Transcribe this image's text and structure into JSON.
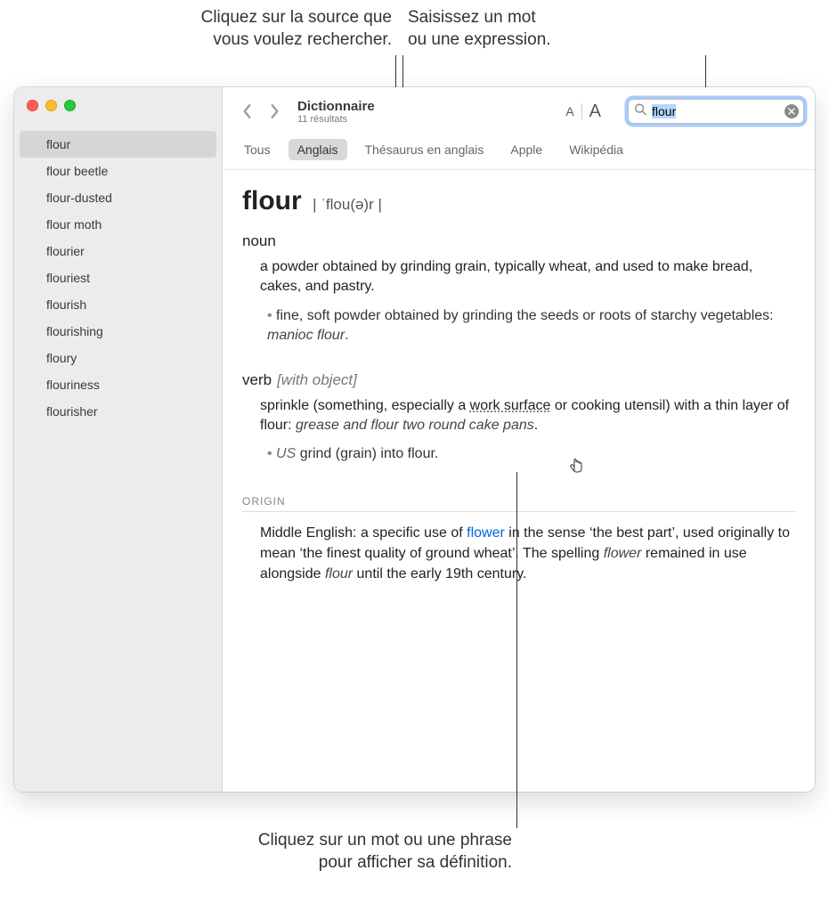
{
  "callouts": {
    "top_left_l1": "Cliquez sur la source que",
    "top_left_l2": "vous voulez rechercher.",
    "top_right_l1": "Saisissez un mot",
    "top_right_l2": "ou une expression.",
    "bottom_l1": "Cliquez sur un mot ou une phrase",
    "bottom_l2": "pour afficher sa définition."
  },
  "window": {
    "title": "Dictionnaire",
    "subtitle": "11 résultats"
  },
  "search": {
    "value": "flour"
  },
  "tabs": [
    "Tous",
    "Anglais",
    "Thésaurus en anglais",
    "Apple",
    "Wikipédia"
  ],
  "active_tab_index": 1,
  "sidebar": {
    "items": [
      "flour",
      "flour beetle",
      "flour-dusted",
      "flour moth",
      "flourier",
      "flouriest",
      "flourish",
      "flourishing",
      "floury",
      "flouriness",
      "flourisher"
    ],
    "selected_index": 0
  },
  "entry": {
    "headword": "flour",
    "pron": "| ˈflou(ə)r |",
    "noun_label": "noun",
    "noun_def": "a powder obtained by grinding grain, typically wheat, and used to make bread, cakes, and pastry.",
    "noun_sub_prefix": "fine, soft powder obtained by grinding the seeds or roots of starchy vegetables: ",
    "noun_sub_example": "manioc flour",
    "noun_sub_suffix": ".",
    "verb_label": "verb",
    "verb_grammar": "[with object]",
    "verb_def_prefix": "sprinkle (something, especially a ",
    "verb_def_link": "work surface",
    "verb_def_mid": " or cooking utensil) with a thin layer of flour: ",
    "verb_def_example": "grease and flour two round cake pans",
    "verb_def_suffix": ".",
    "verb_sub_us": "US",
    "verb_sub_text": " grind (grain) into flour.",
    "origin_head": "ORIGIN",
    "origin_prefix": "Middle English: a specific use of ",
    "origin_link": "flower",
    "origin_mid": " in the sense ‘the best part’, used originally to mean ‘the finest quality of ground wheat’. The spelling ",
    "origin_italic1": "flower",
    "origin_mid2": " remained in use alongside ",
    "origin_italic2": "flour",
    "origin_suffix": " until the early 19th century."
  }
}
